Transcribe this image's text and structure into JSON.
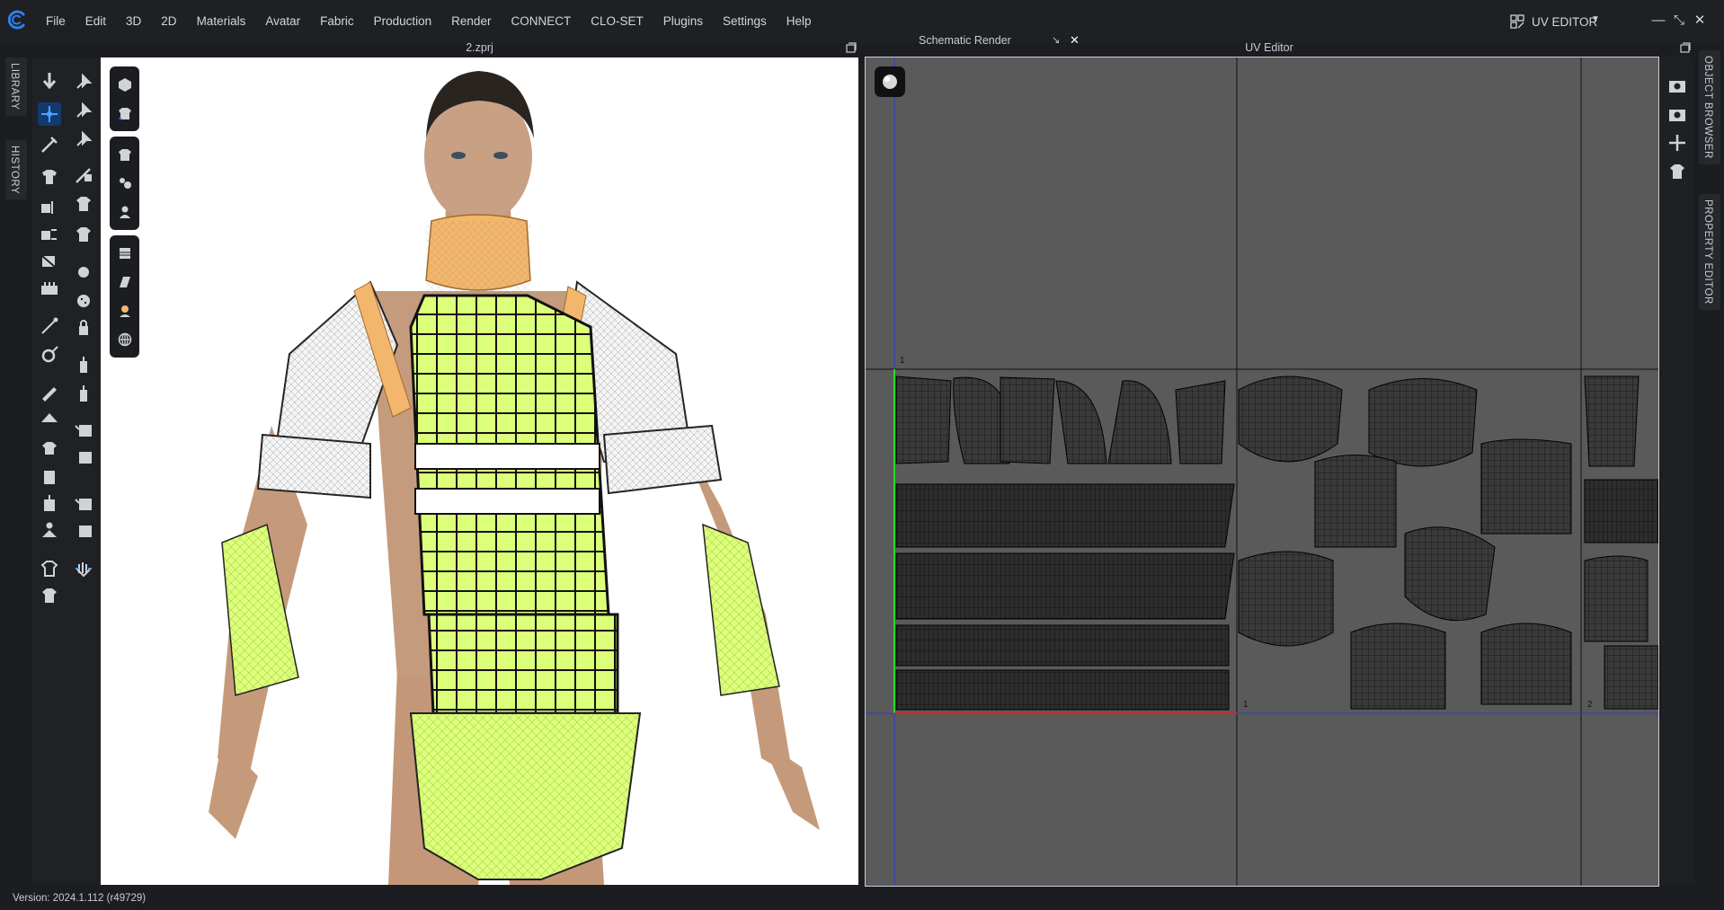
{
  "menubar": {
    "items": [
      "File",
      "Edit",
      "3D",
      "2D",
      "Materials",
      "Avatar",
      "Fabric",
      "Production",
      "Render",
      "CONNECT",
      "CLO-SET",
      "Plugins",
      "Settings",
      "Help"
    ],
    "mode_label": "UV EDITOR"
  },
  "left_tabs": {
    "library": "LIBRARY",
    "history": "HISTORY"
  },
  "right_tabs": {
    "object_browser": "OBJECT BROWSER",
    "property_editor": "PROPERTY EDITOR"
  },
  "viewport": {
    "title": "2.zprj"
  },
  "schematic": {
    "tab_label": "Schematic Render"
  },
  "uv_editor": {
    "title": "UV Editor",
    "tile_labels": [
      "1",
      "1",
      "2"
    ]
  },
  "status": {
    "version": "Version: 2024.1.112 (r49729)"
  },
  "colors": {
    "accent": "#2f80ed",
    "garment_green": "#dcff7a",
    "collar_orange": "#f2b66c",
    "uv_background": "#5a5a5a",
    "uv_axis_green": "#22dd22",
    "uv_axis_red": "#dd2222",
    "uv_grid_blue": "#2b3bdc"
  },
  "icons": {
    "logo": "clo-logo-icon",
    "mode": "uv-editor-icon",
    "viewport_toolbar": [
      "cube-icon",
      "shirt-icon",
      "tshirt-icon",
      "colors-icon",
      "avatar-icon",
      "fabric-icon",
      "texture-icon",
      "skin-icon",
      "globe-icon"
    ]
  }
}
